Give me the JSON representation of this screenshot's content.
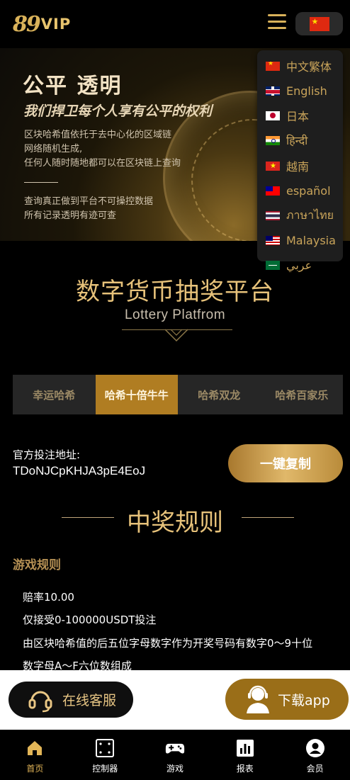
{
  "header": {
    "logo_number": "89",
    "logo_text": "VIP",
    "current_language_flag": "flag-cn-icon"
  },
  "banner": {
    "title": "公平 透明",
    "subtitle": "我们捍卫每个人享有公平的权利",
    "lines": [
      "区块哈希值依托于去中心化的区域链",
      "网络随机生成,",
      "任何人随时随地都可以在区块链上查询"
    ],
    "lines2": [
      "查询真正做到平台不可操控数据",
      "所有记录透明有迹可查"
    ]
  },
  "language_menu": {
    "items": [
      {
        "label": "中文繁体",
        "flag": "flag-cn"
      },
      {
        "label": "English",
        "flag": "flag-en"
      },
      {
        "label": "日本",
        "flag": "flag-jp"
      },
      {
        "label": "हिन्दी",
        "flag": "flag-in"
      },
      {
        "label": "越南",
        "flag": "flag-vn"
      },
      {
        "label": "español",
        "flag": "flag-tw"
      },
      {
        "label": "ภาษาไทย",
        "flag": "flag-th"
      },
      {
        "label": "Malaysia",
        "flag": "flag-my"
      },
      {
        "label": "عربي",
        "flag": "flag-sa"
      }
    ]
  },
  "platform": {
    "title": "数字货币抽奖平台",
    "subtitle": "Lottery Platfrom"
  },
  "tabs": [
    {
      "label": "幸运哈希",
      "active": false
    },
    {
      "label": "哈希十倍牛牛",
      "active": true
    },
    {
      "label": "哈希双龙",
      "active": false
    },
    {
      "label": "哈希百家乐",
      "active": false
    }
  ],
  "address": {
    "label": "官方投注地址:",
    "value": "TDoNJCpKHJA3pE4EoJ",
    "copy_label": "一键复制"
  },
  "rules": {
    "title": "中奖规则",
    "heading": "游戏规则",
    "lines": [
      "赔率10.00",
      "仅接受0-100000USDT投注",
      "由区块哈希值的后五位字母数字作为开奖号码有数字0～9十位",
      "数字母A～F六位数组成"
    ]
  },
  "service": {
    "cs_label": "在线客服",
    "download_label": "下载app"
  },
  "bottom_nav": [
    {
      "label": "首页",
      "icon": "home-icon",
      "active": true
    },
    {
      "label": "控制器",
      "icon": "controller-icon",
      "active": false
    },
    {
      "label": "游戏",
      "icon": "gamepad-icon",
      "active": false
    },
    {
      "label": "报表",
      "icon": "report-icon",
      "active": false
    },
    {
      "label": "会员",
      "icon": "member-icon",
      "active": false
    }
  ],
  "colors": {
    "gold": "#e7c27a",
    "tab_active": "#b07d22",
    "nav_active": "#e2b557"
  }
}
